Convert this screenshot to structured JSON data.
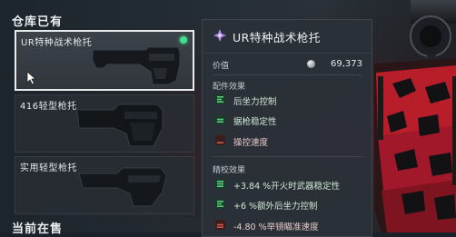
{
  "owned_section": {
    "title": "仓库已有"
  },
  "items": [
    {
      "label": "UR特种战术枪托",
      "selected": true
    },
    {
      "label": "416轻型枪托",
      "selected": false
    },
    {
      "label": "实用轻型枪托",
      "selected": false
    }
  ],
  "on_sale_section": {
    "title": "当前在售"
  },
  "detail": {
    "title": "UR特种战术枪托",
    "price_label": "价值",
    "price_value": "69,373",
    "accessory_effects": {
      "title": "配件效果",
      "rows": [
        {
          "text": "后坐力控制",
          "trend": "up"
        },
        {
          "text": "据枪稳定性",
          "trend": "up"
        },
        {
          "text": "操控速度",
          "trend": "down"
        }
      ]
    },
    "tuning_effects": {
      "title": "精校效果",
      "rows": [
        {
          "text": "+3.84 %开火时武器稳定性",
          "trend": "up"
        },
        {
          "text": "+6 %额外后坐力控制",
          "trend": "up"
        },
        {
          "text": "-4.80 %举镜瞄准速度",
          "trend": "down"
        }
      ]
    }
  },
  "colors": {
    "accent_green": "#3fe08b",
    "up_icon": "#4fd07a",
    "down_icon": "#d9534f",
    "gun_red": "#c8202e"
  }
}
